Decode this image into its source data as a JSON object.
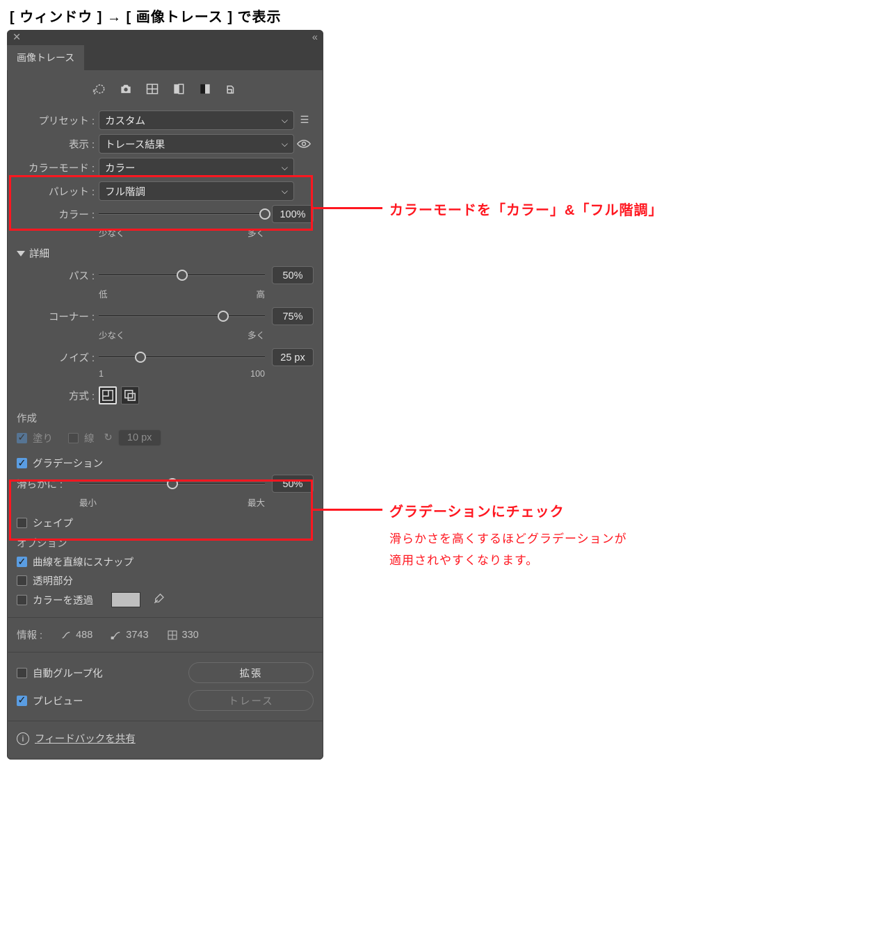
{
  "page_title": "[ ウィンドウ ]  →  [ 画像トレース ] で表示",
  "panel": {
    "tab": "画像トレース",
    "rows": {
      "preset": {
        "label": "プリセット :",
        "value": "カスタム"
      },
      "view": {
        "label": "表示 :",
        "value": "トレース結果"
      },
      "mode": {
        "label": "カラーモード :",
        "value": "カラー"
      },
      "palette": {
        "label": "パレット :",
        "value": "フル階調"
      }
    },
    "color_slider": {
      "label": "カラー :",
      "value": "100%",
      "min": "少なく",
      "max": "多く",
      "pos": 100
    },
    "details_label": "詳細",
    "paths": {
      "label": "パス :",
      "value": "50%",
      "min": "低",
      "max": "高",
      "pos": 50
    },
    "corners": {
      "label": "コーナー :",
      "value": "75%",
      "min": "少なく",
      "max": "多く",
      "pos": 75
    },
    "noise": {
      "label": "ノイズ :",
      "value": "25 px",
      "min": "1",
      "max": "100",
      "pos": 25
    },
    "method_label": "方式 :",
    "create_label": "作成",
    "fill_label": "塗り",
    "stroke_label": "線",
    "stroke_value": "10 px",
    "gradient_label": "グラデーション",
    "smooth": {
      "label": "滑らかに :",
      "value": "50%",
      "min": "最小",
      "max": "最大",
      "pos": 50
    },
    "shape_label": "シェイプ",
    "options_label": "オプション",
    "snap_label": "曲線を直線にスナップ",
    "transparent_label": "透明部分",
    "color_through_label": "カラーを透過",
    "info": {
      "label": "情報 :",
      "paths": "488",
      "anchors": "3743",
      "colors": "330"
    },
    "auto_group_label": "自動グループ化",
    "expand_btn": "拡張",
    "preview_label": "プレビュー",
    "trace_btn": "トレース",
    "feedback": "フィードバックを共有"
  },
  "callouts": {
    "c1": "カラーモードを「カラー」&「フル階調」",
    "c2_title": "グラデーションにチェック",
    "c2_sub1": "滑らかさを高くするほどグラデーションが",
    "c2_sub2": "適用されやすくなります。"
  }
}
